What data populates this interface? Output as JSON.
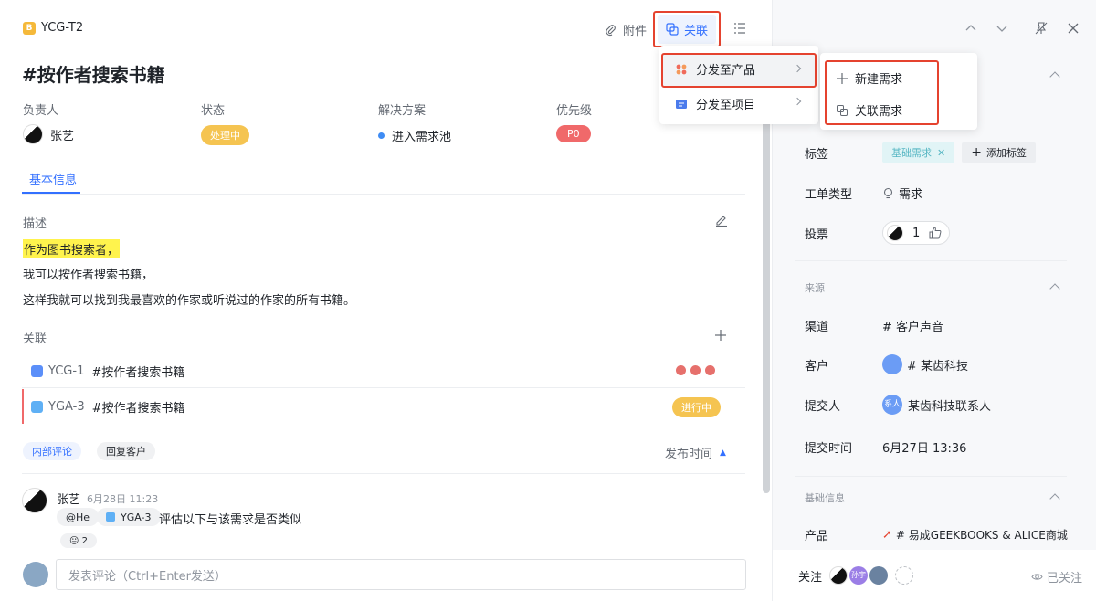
{
  "header": {
    "ticket_id": "YCG-T2",
    "attach_label": "附件",
    "link_label": "关联"
  },
  "title": "#按作者搜索书籍",
  "fields": {
    "assignee_label": "负责人",
    "assignee_value": "张艺",
    "status_label": "状态",
    "status_value": "处理中",
    "solution_label": "解决方案",
    "solution_value": "进入需求池",
    "priority_label": "优先级",
    "priority_value": "P0"
  },
  "tabs": [
    "基本信息"
  ],
  "description": {
    "label": "描述",
    "lines": [
      "作为图书搜索者，",
      "我可以按作者搜索书籍，",
      "这样我就可以找到我最喜欢的作家或听说过的作家的所有书籍。"
    ]
  },
  "relations": {
    "label": "关联",
    "items": [
      {
        "id": "YCG-1",
        "title": "#按作者搜索书籍",
        "status": ""
      },
      {
        "id": "YGA-3",
        "title": "#按作者搜索书籍",
        "status": "进行中"
      }
    ]
  },
  "comments": {
    "tabs": [
      "内部评论",
      "回复客户"
    ],
    "sort_label": "发布时间",
    "items": [
      {
        "author": "张艺",
        "time": "6月28日 11:23",
        "mention": "@He",
        "ref": "YGA-3",
        "text": "评估以下与该需求是否类似",
        "reaction": "😐 2"
      }
    ],
    "input_placeholder": "发表评论（Ctrl+Enter发送）"
  },
  "menu": {
    "items": [
      "分发至产品",
      "分发至项目"
    ],
    "submenu": [
      "新建需求",
      "关联需求"
    ]
  },
  "side": {
    "tags_label": "标签",
    "tag_value": "基础需求",
    "add_tag": "添加标签",
    "type_label": "工单类型",
    "type_value": "需求",
    "vote_label": "投票",
    "vote_count": "1",
    "source_section": "来源",
    "channel_label": "渠道",
    "channel_value": "# 客户声音",
    "customer_label": "客户",
    "customer_value": "# 某齿科技",
    "submitter_label": "提交人",
    "submitter_avatar": "系人",
    "submitter_value": "某齿科技联系人",
    "submit_time_label": "提交时间",
    "submit_time_value": "6月27日 13:36",
    "basic_section": "基础信息",
    "product_label": "产品",
    "product_value": "# 易成GEEKBOOKS & ALICE商城",
    "follow_label": "关注",
    "follower2": "孙宇",
    "followed_label": "已关注"
  }
}
